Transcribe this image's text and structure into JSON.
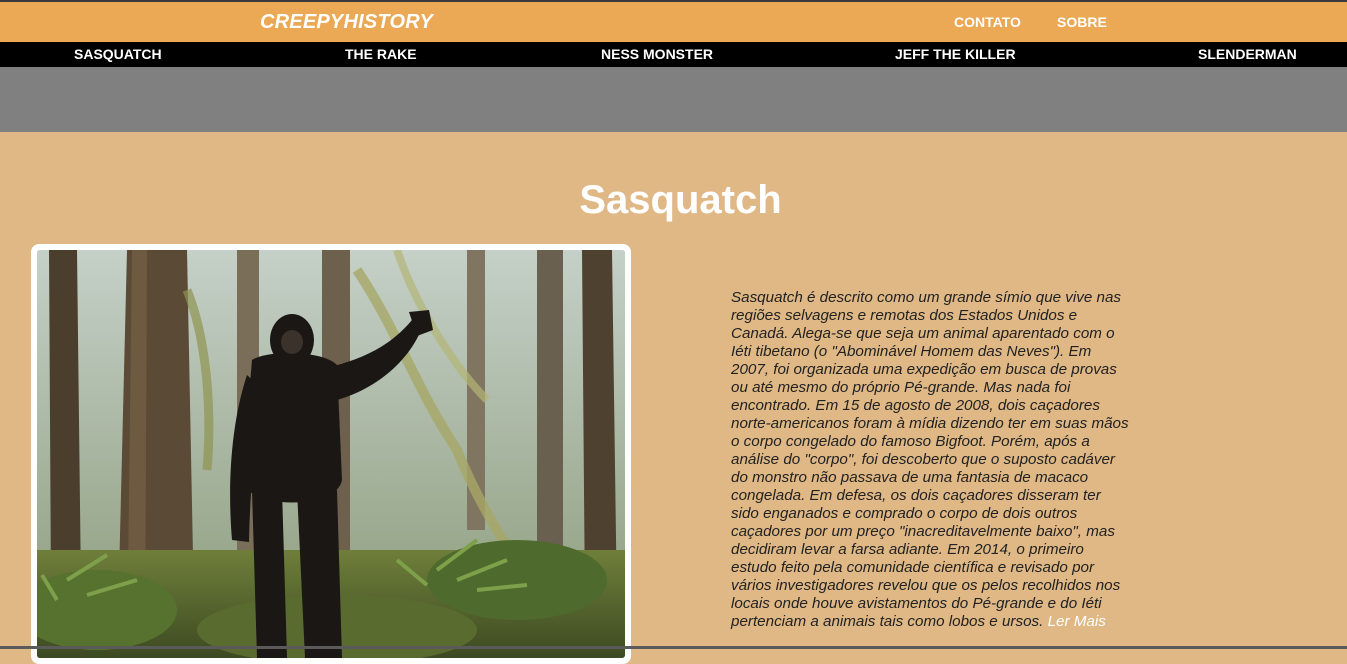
{
  "header": {
    "logo": "CREEPYHISTORY",
    "links": [
      "CONTATO",
      "SOBRE"
    ]
  },
  "nav": {
    "items": [
      "SASQUATCH",
      "THE RAKE",
      "NESS MONSTER",
      "JEFF THE KILLER",
      "SLENDERMAN"
    ]
  },
  "main": {
    "title": "Sasquatch",
    "image_alt": "Sasquatch in a mossy forest",
    "description": "Sasquatch é descrito como um grande símio que vive nas regiões selvagens e remotas dos Estados Unidos e Canadá. Alega-se que seja um animal aparentado com o Iéti tibetano (o \"Abominável Homem das Neves\"). Em 2007, foi organizada uma expedição em busca de provas ou até mesmo do próprio Pé-grande. Mas nada foi encontrado. Em 15 de agosto de 2008, dois caçadores norte-americanos foram à mídia dizendo ter em suas mãos o corpo congelado do famoso Bigfoot. Porém, após a análise do \"corpo\", foi descoberto que o suposto cadáver do monstro não passava de uma fantasia de macaco congelada. Em defesa, os dois caçadores disseram ter sido enganados e comprado o corpo de dois outros caçadores por um preço \"inacreditavelmente baixo\", mas decidiram levar a farsa adiante. Em 2014, o primeiro estudo feito pela comunidade científica e revisado por vários investigadores revelou que os pelos recolhidos nos locais onde houve avistamentos do Pé-grande e do Iéti pertenciam a animais tais como lobos e ursos.",
    "read_more": "Ler Mais"
  },
  "colors": {
    "header_bg": "#eba955",
    "nav_bg": "#000000",
    "banner_bg": "#808080",
    "page_bg": "#dfb885"
  }
}
